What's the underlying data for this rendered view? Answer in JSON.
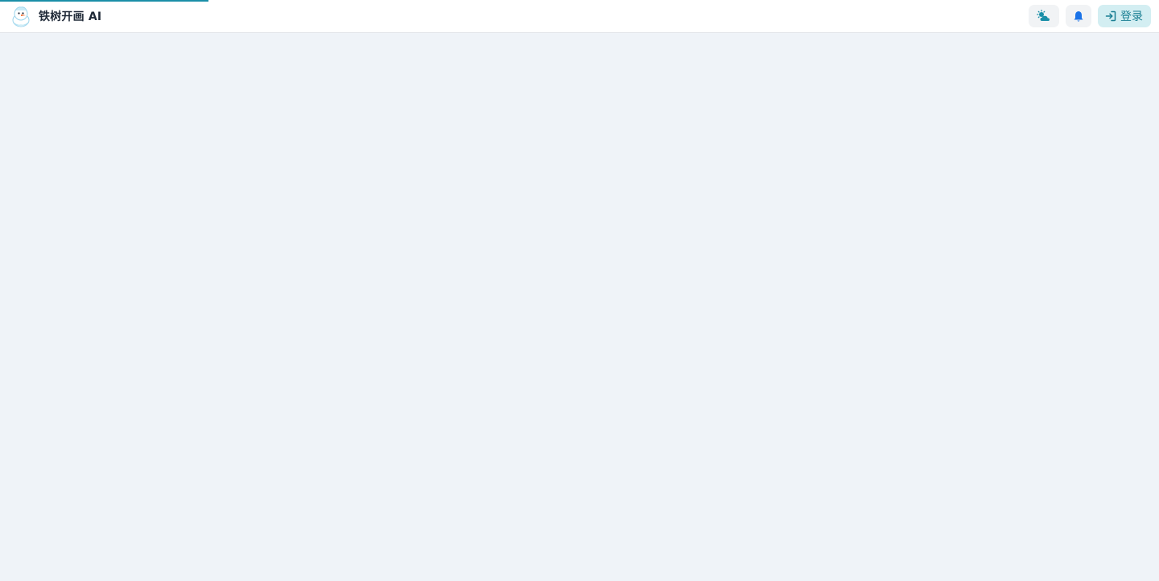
{
  "app": {
    "title": "铁树开画 AI",
    "loading_progress": 0.18
  },
  "header": {
    "logo_icon": "snowman-mascot-icon",
    "theme_icon": "weather-toggle-icon",
    "notification_icon": "bell-icon",
    "login_icon": "sign-in-icon",
    "login_label": "登录"
  },
  "colors": {
    "accent": "#1a8fa8",
    "login_text": "#1a7f93",
    "login_bg": "#d3eef2",
    "bell": "#1a73e8",
    "page_bg": "#eff3f8"
  }
}
